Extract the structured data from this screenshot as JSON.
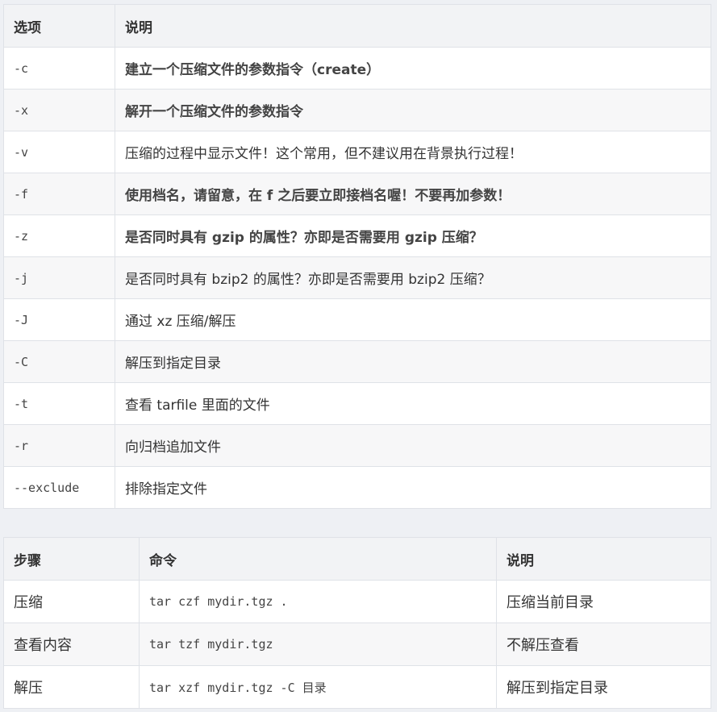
{
  "options_table": {
    "headers": [
      "选项",
      "说明"
    ],
    "rows": [
      {
        "option": "-c",
        "desc": "建立一个压缩文件的参数指令（create）",
        "bold": true
      },
      {
        "option": "-x",
        "desc": "解开一个压缩文件的参数指令",
        "bold": true
      },
      {
        "option": "-v",
        "desc": "压缩的过程中显示文件！这个常用，但不建议用在背景执行过程！",
        "bold": false
      },
      {
        "option": "-f",
        "desc": "使用档名，请留意，在 f 之后要立即接档名喔！不要再加参数！",
        "bold": true
      },
      {
        "option": "-z",
        "desc": "是否同时具有 gzip 的属性？亦即是否需要用 gzip 压缩？",
        "bold": true
      },
      {
        "option": "-j",
        "desc": "是否同时具有 bzip2 的属性？亦即是否需要用 bzip2 压缩？",
        "bold": false
      },
      {
        "option": "-J",
        "desc": "通过 xz 压缩/解压",
        "bold": false
      },
      {
        "option": "-C",
        "desc": "解压到指定目录",
        "bold": false
      },
      {
        "option": "-t",
        "desc": "查看 tarfile 里面的文件",
        "bold": false
      },
      {
        "option": "-r",
        "desc": "向归档追加文件",
        "bold": false
      },
      {
        "option": "--exclude",
        "desc": "排除指定文件",
        "bold": false
      }
    ]
  },
  "commands_table": {
    "headers": [
      "步骤",
      "命令",
      "说明"
    ],
    "rows": [
      {
        "step": "压缩",
        "command": "tar czf mydir.tgz .",
        "note": "压缩当前目录"
      },
      {
        "step": "查看内容",
        "command": "tar tzf mydir.tgz",
        "note": "不解压查看"
      },
      {
        "step": "解压",
        "command": "tar xzf mydir.tgz -C 目录",
        "note": "解压到指定目录"
      }
    ]
  }
}
